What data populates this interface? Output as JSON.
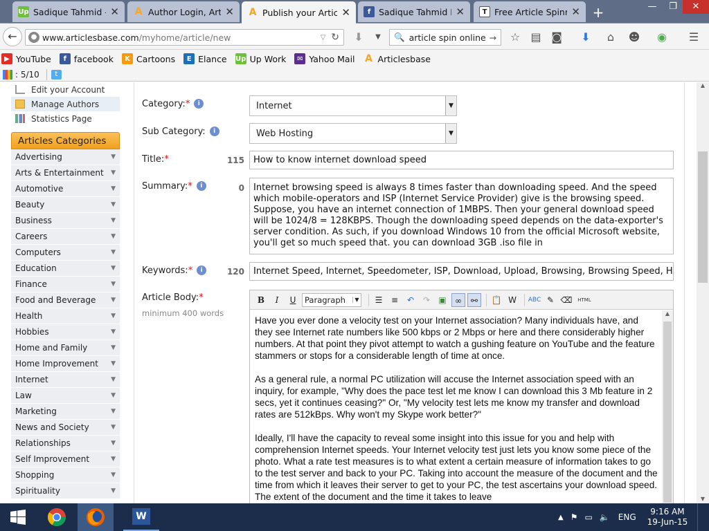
{
  "browser": {
    "tabs": [
      {
        "title": "Sadique Tahmid - ...",
        "icon": "upwork-icon",
        "active": false
      },
      {
        "title": "Author Login, Arti...",
        "icon": "articlesbase-icon",
        "active": false
      },
      {
        "title": "Publish your Articl...",
        "icon": "articlesbase-icon",
        "active": true
      },
      {
        "title": "Sadique Tahmid R...",
        "icon": "facebook-icon",
        "active": false
      },
      {
        "title": "Free Article Spinne...",
        "icon": "spinner-icon",
        "active": false
      }
    ],
    "url_domain": "www.articlesbase.com",
    "url_path": "/myhome/article/new",
    "search_value": "article spin online",
    "bookmarks": [
      {
        "label": "YouTube",
        "icon": "youtube-icon"
      },
      {
        "label": "facebook",
        "icon": "facebook-icon"
      },
      {
        "label": "Cartoons",
        "icon": "cartoons-icon"
      },
      {
        "label": "Elance",
        "icon": "elance-icon"
      },
      {
        "label": "Up Work",
        "icon": "upwork-icon"
      },
      {
        "label": "Yahoo Mail",
        "icon": "yahoo-mail-icon"
      },
      {
        "label": "Articlesbase",
        "icon": "articlesbase-icon"
      }
    ],
    "addon_count": ": 5/10"
  },
  "sidebar": {
    "account_items": [
      "Edit your Account",
      "Manage Authors",
      "Statistics Page"
    ],
    "categories_title": "Articles Categories",
    "categories": [
      "Advertising",
      "Arts & Entertainment",
      "Automotive",
      "Beauty",
      "Business",
      "Careers",
      "Computers",
      "Education",
      "Finance",
      "Food and Beverage",
      "Health",
      "Hobbies",
      "Home and Family",
      "Home Improvement",
      "Internet",
      "Law",
      "Marketing",
      "News and Society",
      "Relationships",
      "Self Improvement",
      "Shopping",
      "Spirituality"
    ]
  },
  "form": {
    "category_label": "Category:",
    "category_value": "Internet",
    "subcategory_label": "Sub Category:",
    "subcategory_value": "Web Hosting",
    "title_label": "Title:",
    "title_count": "115",
    "title_value": "How to know internet download speed",
    "summary_label": "Summary:",
    "summary_count": "0",
    "summary_value": "Internet browsing speed is always 8 times faster than downloading speed. And the speed which mobile-operators and ISP (Internet Service Provider) give is the browsing speed. Suppose, you have an internet connection of 1MBPS. Then your general download speed will be 1024/8 = 128KBPS. Though the downloading speed depends on the data-exporter's server condition. As such, if you download Windows 10 from the official Microsoft website, you'll get so much speed that. you can download 3GB .iso file in",
    "keywords_label": "Keywords:",
    "keywords_count": "120",
    "keywords_value": "Internet Speed, Internet, Speedometer, ISP, Download, Upload, Browsing, Browsing Speed, How",
    "body_label": "Article Body:",
    "body_hint": "minimum 400 words",
    "format_value": "Paragraph",
    "toolbar_html": "HTML",
    "body_paragraphs": [
      "Have you ever done a velocity test on your Internet association? Many individuals have, and they see Internet rate numbers like 500 kbps or 2 Mbps or here and there considerably higher numbers. At that point they pivot attempt to watch a gushing feature on YouTube and the feature stammers or stops for a considerable length of time at once.",
      "As a general rule, a normal PC utilization will accuse the Internet association speed with an inquiry, for example, \"Why does the pace test let me know I can download this 3 Mb feature in 2 secs, yet it continues ceasing?\" Or, \"My velocity test lets me know my transfer and download rates are 512kBps. Why won't my Skype work better?\"",
      "Ideally, I'll have the capacity to reveal some insight into this issue for you and help with comprehension Internet speeds. Your Internet velocity test just lets you know some piece of the photo. What a rate test measures is to what extent a certain measure of information takes to go to the test server and back to your PC. Taking into account the measure of the document and the time from which it leaves their server to get to your PC, the test ascertains your download speed. The extent of the document and the time it takes to leave"
    ]
  },
  "taskbar": {
    "language": "ENG",
    "time": "9:16 AM",
    "date": "19-Jun-15",
    "word_label": "W"
  },
  "colors": {
    "accent": "#f5a623",
    "tab_strip": "#5f6d86",
    "taskbar": "#1b2d4a"
  }
}
